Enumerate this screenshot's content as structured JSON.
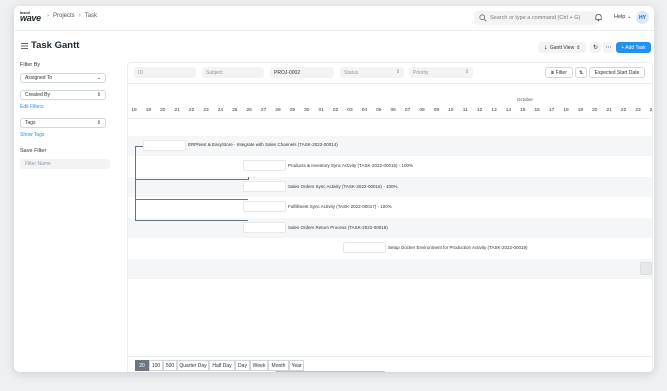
{
  "app": {
    "logo_small": "brand",
    "logo_big": "wave"
  },
  "breadcrumbs": [
    "Projects",
    "Task"
  ],
  "search": {
    "placeholder": "Search or type a command (Ctrl + G)"
  },
  "help_label": "Help",
  "avatar_initials": "HY",
  "page": {
    "title": "Task Gantt",
    "view_select": "Gantt View",
    "add_button": "+ Add Task"
  },
  "sidebar": {
    "filter_by_label": "Filter By",
    "assigned_to": "Assigned To",
    "created_by": "Created By",
    "edit_filters": "Edit Filters",
    "tags": "Tags",
    "show_tags": "Show Tags",
    "save_filter_label": "Save Filter",
    "filter_name_placeholder": "Filter Name"
  },
  "filters": {
    "id_placeholder": "ID",
    "subject_placeholder": "Subject",
    "project_value": "PROJ-0002",
    "status_placeholder": "Status",
    "priority_placeholder": "Priority",
    "filter_button": "Filter",
    "sort_field": "Expected Start Date"
  },
  "gantt": {
    "month_label": "October",
    "days": [
      "18",
      "19",
      "20",
      "21",
      "22",
      "23",
      "24",
      "25",
      "26",
      "27",
      "28",
      "29",
      "30",
      "01",
      "02",
      "03",
      "04",
      "05",
      "06",
      "07",
      "08",
      "09",
      "10",
      "11",
      "12",
      "13",
      "14",
      "15",
      "16",
      "17",
      "18",
      "19",
      "20",
      "21",
      "22",
      "23",
      "24"
    ],
    "tasks": [
      {
        "label": "ERPNext & EasyStore - Integrate with Sales Channels (TASK-2022-00014)"
      },
      {
        "label": "Products & Inventory Sync Activity (TASK-2022-00015) - 100%"
      },
      {
        "label": "Sales Orders Sync Activity (TASK-2022-00016) - 100%"
      },
      {
        "label": "Fulfillment Sync Activity (TASK-2022-00017) - 100%"
      },
      {
        "label": "Sales Orders Return Process (TASK-2022-00018)"
      },
      {
        "label": "Setup Docker Environment for Production Activity (TASK-2022-00019)"
      }
    ]
  },
  "view_modes": [
    "20",
    "100",
    "500",
    "Quarter Day",
    "Half Day",
    "Day",
    "Week",
    "Month",
    "Year"
  ],
  "active_view_mode": "20"
}
